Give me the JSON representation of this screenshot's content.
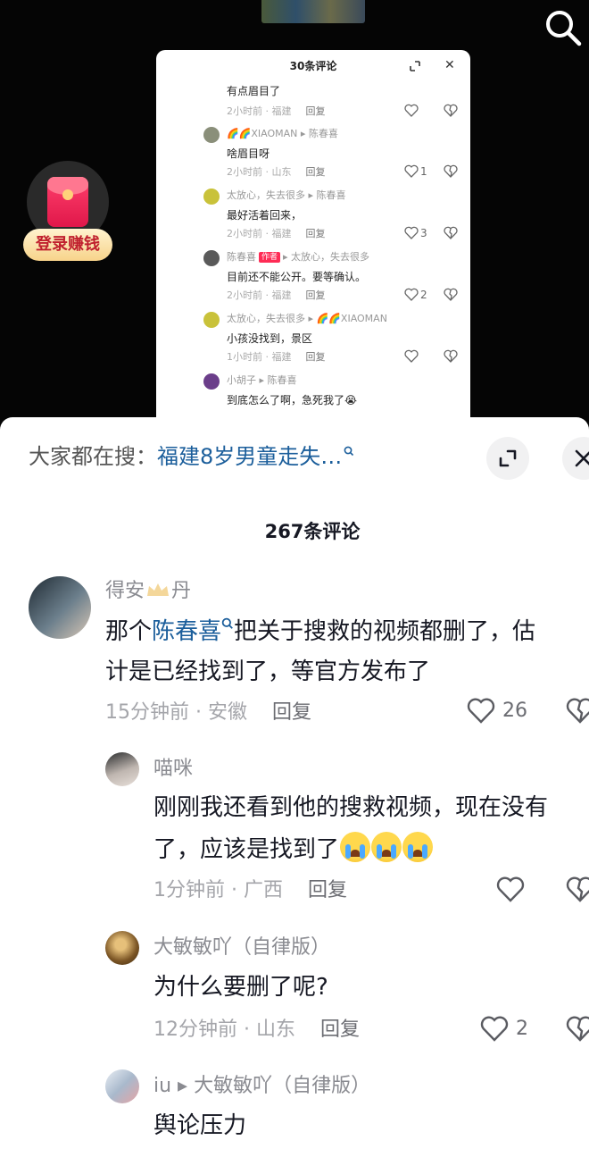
{
  "video": {
    "login_label": "登录赚钱"
  },
  "mini_panel": {
    "title": "30条评论",
    "comments": [
      {
        "text": "有点眉目了",
        "time": "2小时前",
        "location": "福建",
        "reply": "回复",
        "likes": ""
      },
      {
        "user": "🌈🌈XIAOMAN",
        "reply_to": "陈春喜",
        "text": "啥眉目呀",
        "time": "2小时前",
        "location": "山东",
        "reply": "回复",
        "likes": "1"
      },
      {
        "user": "太放心，失去很多",
        "reply_to": "陈春喜",
        "text": "最好活着回来，",
        "time": "2小时前",
        "location": "福建",
        "reply": "回复",
        "likes": "3"
      },
      {
        "user": "陈春喜",
        "author_tag": "作者",
        "reply_to": "太放心，失去很多",
        "text": "目前还不能公开。要等确认。",
        "time": "2小时前",
        "location": "福建",
        "reply": "回复",
        "likes": "2"
      },
      {
        "user": "太放心，失去很多",
        "reply_to": "🌈🌈XIAOMAN",
        "text": "小孩没找到，景区",
        "time": "1小时前",
        "location": "福建",
        "reply": "回复",
        "likes": ""
      },
      {
        "user": "小胡子",
        "reply_to": "陈春喜",
        "text": "到底怎么了啊，急死我了😭"
      }
    ]
  },
  "sheet": {
    "search_prefix": "大家都在搜：",
    "search_term": "福建8岁男童走失…",
    "title": "267条评论",
    "comments": [
      {
        "user_a": "得安",
        "user_b": "丹",
        "text_1_prefix": "那个",
        "text_1_mention": "陈春喜",
        "text_1_suffix": "把关于搜救的视频都删了，估",
        "text_2": "计是已经找到了，等官方发布了",
        "time": "15分钟前",
        "sep": "·",
        "location": "安徽",
        "reply": "回复",
        "likes": "26"
      },
      {
        "user": "喵咪",
        "text_1": "刚刚我还看到他的搜救视频，现在没有",
        "text_2": "了，应该是找到了",
        "time": "1分钟前",
        "sep": "·",
        "location": "广西",
        "reply": "回复",
        "likes": ""
      },
      {
        "user": "大敏敏吖（自律版）",
        "text_1": "为什么要删了呢?",
        "time": "12分钟前",
        "sep": "·",
        "location": "山东",
        "reply": "回复",
        "likes": "2"
      },
      {
        "user": "iu",
        "reply_to": "大敏敏吖（自律版）",
        "text_1": "舆论压力"
      }
    ]
  },
  "colors": {
    "accent_red": "#fe2c55",
    "mention_blue": "#1b5e9b",
    "meta_gray": "#a4a5aa"
  }
}
